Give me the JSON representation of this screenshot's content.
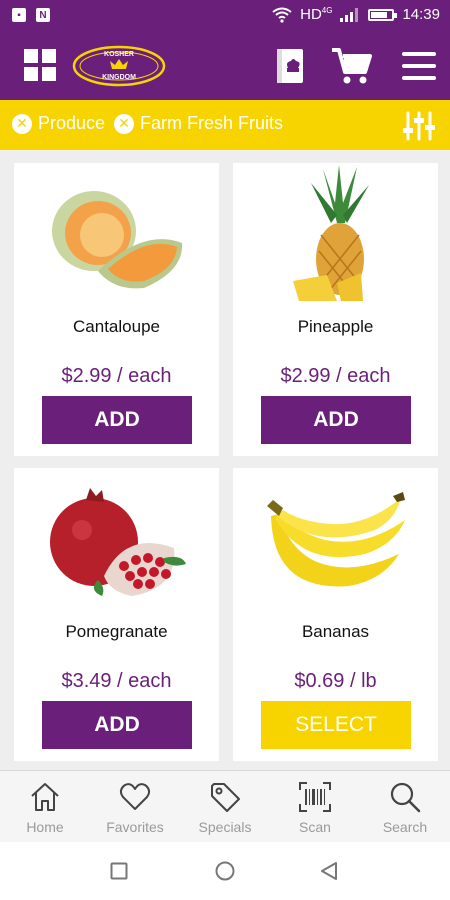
{
  "status_bar": {
    "time": "14:39",
    "network": "HD",
    "network_sup": "4G",
    "battery_level": 0.9
  },
  "header": {
    "logo_text_top": "KOSHER",
    "logo_text_bottom": "KINGDOM"
  },
  "filters": {
    "chips": [
      {
        "label": "Produce"
      },
      {
        "label": "Farm Fresh Fruits"
      }
    ]
  },
  "products": [
    {
      "name": "Cantaloupe",
      "price": "$2.99 / each",
      "button": "ADD"
    },
    {
      "name": "Pineapple",
      "price": "$2.99 / each",
      "button": "ADD"
    },
    {
      "name": "Pomegranate",
      "price": "$3.49 / each",
      "button": "ADD"
    },
    {
      "name": "Bananas",
      "price": "$0.69 / lb",
      "button": "SELECT"
    }
  ],
  "bottom_nav": [
    {
      "label": "Home",
      "icon": "home-icon"
    },
    {
      "label": "Favorites",
      "icon": "heart-icon"
    },
    {
      "label": "Specials",
      "icon": "tag-icon"
    },
    {
      "label": "Scan",
      "icon": "barcode-icon"
    },
    {
      "label": "Search",
      "icon": "search-icon"
    }
  ],
  "colors": {
    "brand_purple": "#6a1f7a",
    "accent_yellow": "#f7d400",
    "background": "#eeeeee"
  }
}
